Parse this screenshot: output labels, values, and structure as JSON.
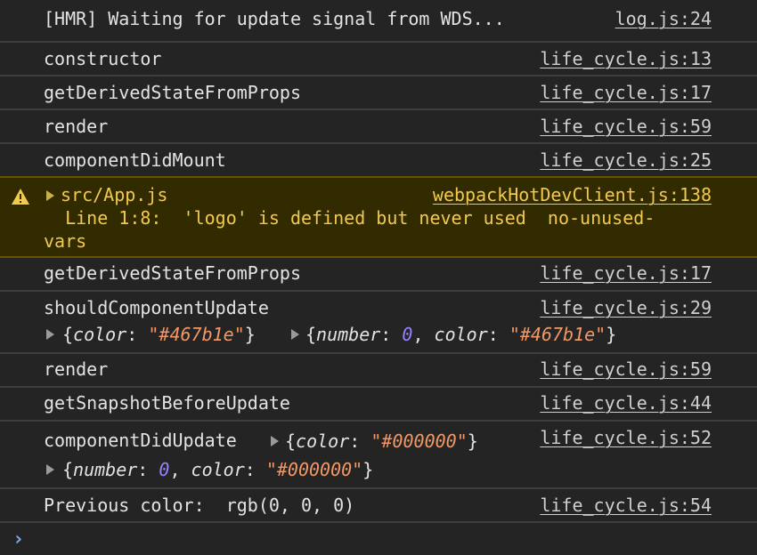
{
  "console": {
    "rows": [
      {
        "msg": "[HMR] Waiting for update signal from WDS...",
        "src": "log.js:24"
      },
      {
        "msg": "constructor",
        "src": "life_cycle.js:13"
      },
      {
        "msg": "getDerivedStateFromProps",
        "src": "life_cycle.js:17"
      },
      {
        "msg": "render",
        "src": "life_cycle.js:59"
      },
      {
        "msg": "componentDidMount",
        "src": "life_cycle.js:25"
      },
      {
        "msg": "src/App.js",
        "src": "webpackHotDevClient.js:138",
        "line1": "  Line 1:8:  'logo' is defined but never used  no-unused-",
        "line2": "vars"
      },
      {
        "msg": "getDerivedStateFromProps",
        "src": "life_cycle.js:17"
      },
      {
        "msg": "shouldComponentUpdate",
        "src": "life_cycle.js:29"
      },
      {
        "msg": "render",
        "src": "life_cycle.js:59"
      },
      {
        "msg": "getSnapshotBeforeUpdate",
        "src": "life_cycle.js:44"
      },
      {
        "msg": "componentDidUpdate",
        "src": "life_cycle.js:52"
      },
      {
        "msg": "Previous color:  rgb(0, 0, 0)",
        "src": "life_cycle.js:54"
      }
    ],
    "scu_obj1": {
      "open": "{",
      "key": "color",
      "sep": ": ",
      "val": "\"#467b1e\"",
      "close": "}"
    },
    "scu_obj2": {
      "open": "{",
      "k1": "number",
      "sep": ": ",
      "v1": "0",
      "comma": ", ",
      "k2": "color",
      "v2": "\"#467b1e\"",
      "close": "}"
    },
    "cdu_obj1": {
      "open": "{",
      "key": "color",
      "sep": ": ",
      "val": "\"#000000\"",
      "close": "}"
    },
    "cdu_obj2": {
      "open": "{",
      "k1": "number",
      "sep": ": ",
      "v1": "0",
      "comma": ", ",
      "k2": "color",
      "v2": "\"#000000\"",
      "close": "}"
    },
    "prompt": "›",
    "colors": {
      "bg": "#242424",
      "warning_bg": "#332b00",
      "warning_text": "#f2c94c",
      "string": "#f29766",
      "number": "#9980ff",
      "prompt": "#7cacf8"
    }
  }
}
